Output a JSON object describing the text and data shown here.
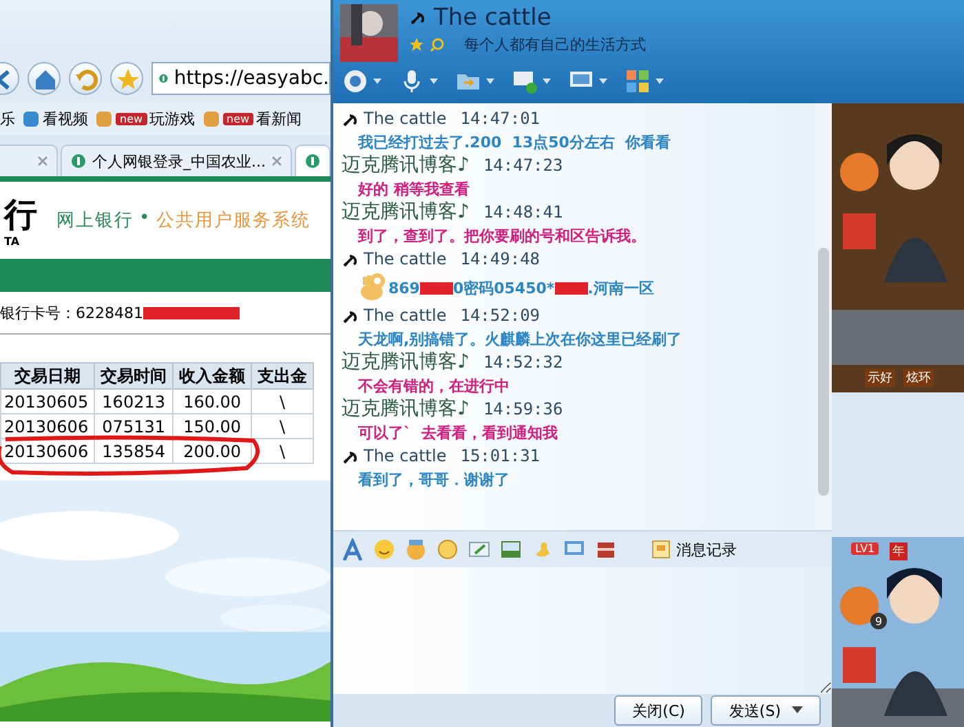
{
  "browser": {
    "url": "https://easyabc.",
    "bookmarks": [
      {
        "label": "乐"
      },
      {
        "label": "看视频"
      },
      {
        "label": "玩游戏",
        "badge": "new"
      },
      {
        "label": "看新闻",
        "badge": "new"
      }
    ],
    "tabs": [
      {
        "selected": false
      },
      {
        "label": "个人网银登录_中国农业...",
        "selected": false
      },
      {
        "selected": true
      }
    ],
    "bank": {
      "logo_char": "行",
      "logo_sub": "TA",
      "title": "网上银行",
      "separator": "•",
      "subtitle": "公共用户服务系统",
      "card_label": "银行卡号：",
      "card_number": "6228481",
      "card_redacted": true
    },
    "table": {
      "columns": [
        "交易日期",
        "交易时间",
        "收入金额",
        "支出金"
      ],
      "rows": [
        {
          "cells": [
            "20130605",
            "160213",
            "160.00",
            "\\"
          ],
          "circled": false
        },
        {
          "cells": [
            "20130606",
            "075131",
            "150.00",
            "\\"
          ],
          "circled": false
        },
        {
          "cells": [
            "20130606",
            "135854",
            "200.00",
            "\\"
          ],
          "circled": true
        }
      ]
    }
  },
  "chat": {
    "contact": {
      "name": "The cattle",
      "signature": "每个人都有自己的生活方式"
    },
    "messages": [
      {
        "kind": "them",
        "sender": "The cattle",
        "time": "14:47:01",
        "text": "我已经打过去了.200  13点50分左右  你看看"
      },
      {
        "kind": "me",
        "sender": "迈克腾讯博客♪",
        "time": "14:47:23",
        "text": "好的 稍等我查看"
      },
      {
        "kind": "me",
        "sender": "迈克腾讯博客♪",
        "time": "14:48:41",
        "text": "到了，查到了。把你要刷的号和区告诉我。"
      },
      {
        "kind": "them",
        "sender": "The cattle",
        "time": "14:49:48",
        "parts": [
          {
            "kind": "emoji"
          },
          {
            "kind": "text",
            "text": "869"
          },
          {
            "kind": "redacted"
          },
          {
            "kind": "text",
            "text": "0密码05450*"
          },
          {
            "kind": "redacted"
          },
          {
            "kind": "text",
            "text": ".河南一区"
          }
        ]
      },
      {
        "kind": "them",
        "sender": "The cattle",
        "time": "14:52:09",
        "text": "天龙啊,别搞错了。火麒麟上次在你这里已经刷了"
      },
      {
        "kind": "me",
        "sender": "迈克腾讯博客♪",
        "time": "14:52:32",
        "text": "不会有错的，在进行中"
      },
      {
        "kind": "me",
        "sender": "迈克腾讯博客♪",
        "time": "14:59:36",
        "text": "可以了`  去看看，看到通知我"
      },
      {
        "kind": "them",
        "sender": "The cattle",
        "time": "15:01:31",
        "text": "看到了，哥哥．谢谢了"
      }
    ],
    "history_label": "消息记录",
    "buttons": [
      "关闭(C)",
      "发送(S)"
    ],
    "show_top": {
      "actions": [
        "示好",
        "炫环"
      ]
    },
    "show_bottom": {
      "level_badge": "LV1",
      "year_badge": "年",
      "gift_count": "9"
    }
  }
}
